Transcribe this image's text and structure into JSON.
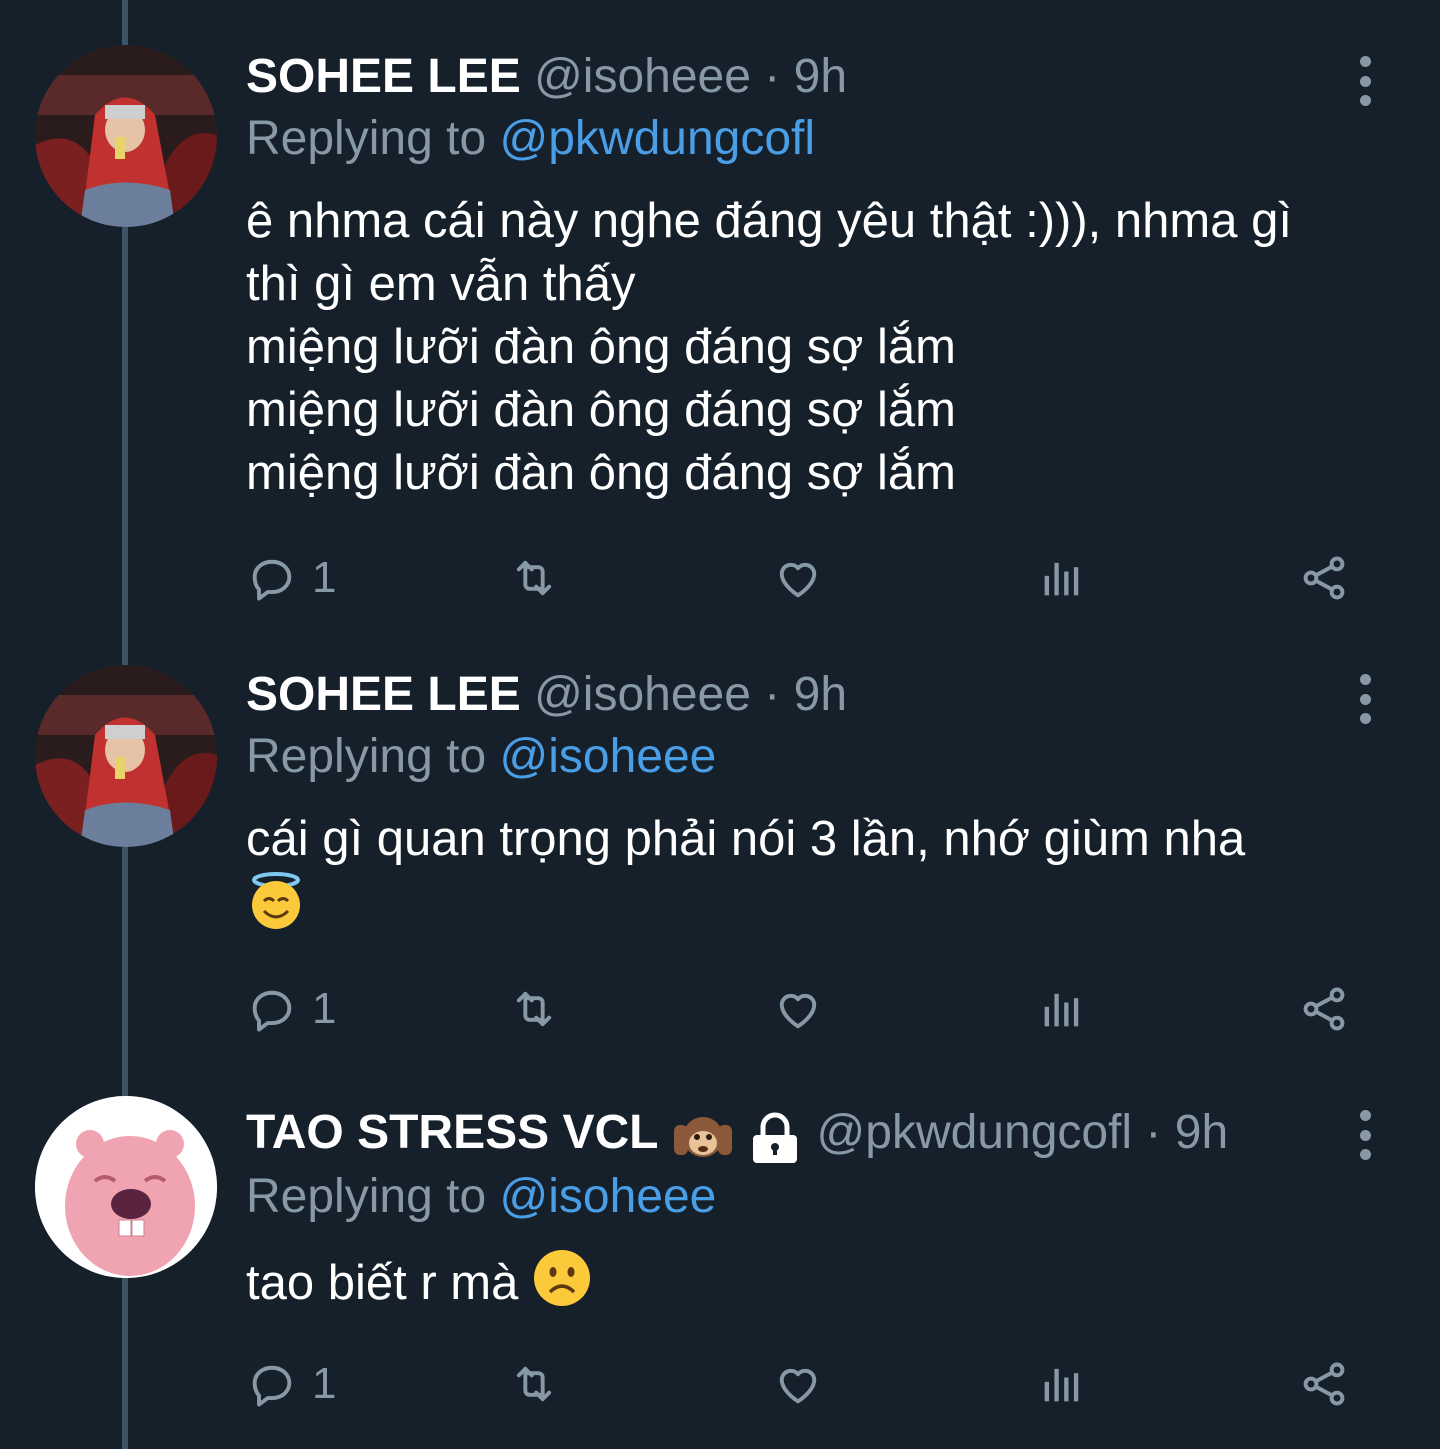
{
  "tweets": [
    {
      "name": "SOHEE LEE",
      "handle": "@isoheee",
      "separator": "·",
      "time": "9h",
      "replying_prefix": "Replying to",
      "replying_handle": "@pkwdungcofl",
      "text_lines": [
        "ê nhma cái này nghe đáng yêu thật :))), nhma gì",
        "thì gì em vẫn thấy",
        "miệng lưỡi đàn ông đáng sợ lắm",
        "miệng lưỡi đàn ông đáng sợ lắm",
        "miệng lưỡi đàn ông đáng sợ lắm"
      ],
      "reply_count": "1",
      "avatar": "person-red-hoodie"
    },
    {
      "name": "SOHEE LEE",
      "handle": "@isoheee",
      "separator": "·",
      "time": "9h",
      "replying_prefix": "Replying to",
      "replying_handle": "@isoheee",
      "text_lines": [
        "cái gì quan trọng phải nói 3 lần, nhớ giùm nha"
      ],
      "emoji": "smiling-face-with-halo",
      "reply_count": "1",
      "avatar": "person-red-hoodie"
    },
    {
      "name": "TAO STRESS VCL",
      "name_badges": [
        "hear-no-evil-monkey",
        "lock-icon"
      ],
      "handle": "@pkwdungcofl",
      "separator": "·",
      "time": "9h",
      "replying_prefix": "Replying to",
      "replying_handle": "@isoheee",
      "text": "tao biết r mà",
      "emoji": "frowning-face",
      "reply_count": "1",
      "avatar": "pink-beaver-character"
    }
  ],
  "icons": {
    "reply": "reply-icon",
    "retweet": "retweet-icon",
    "like": "like-icon",
    "analytics": "analytics-icon",
    "share": "share-icon",
    "more": "more-vertical-icon"
  },
  "colors": {
    "background": "#15202b",
    "secondary_text": "#8899a6",
    "link": "#4a9ee6",
    "thread_line": "#3d5466"
  }
}
